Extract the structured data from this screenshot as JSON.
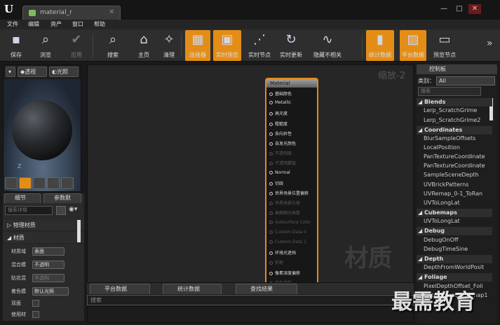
{
  "window": {
    "tab_title": "material_r",
    "min": "—",
    "max": "□",
    "close": "✕"
  },
  "menu": [
    "文件",
    "编辑",
    "资产",
    "窗口",
    "帮助"
  ],
  "toolbar": [
    {
      "label": "保存",
      "icon": "save-icon",
      "glyph": "▪",
      "on": false,
      "dis": false
    },
    {
      "label": "浏览",
      "icon": "browse-icon",
      "glyph": "⌕",
      "on": false,
      "dis": false
    },
    {
      "label": "应用",
      "icon": "apply-icon",
      "glyph": "✔",
      "on": false,
      "dis": true
    },
    {
      "label": "搜索",
      "icon": "search-icon",
      "glyph": "⌕",
      "on": false,
      "dis": false
    },
    {
      "label": "主页",
      "icon": "home-icon",
      "glyph": "⌂",
      "on": false,
      "dis": false
    },
    {
      "label": "清理",
      "icon": "clean-icon",
      "glyph": "✧",
      "on": false,
      "dis": false
    },
    {
      "label": "连接器",
      "icon": "connector-icon",
      "glyph": "▦",
      "on": true,
      "dis": false
    },
    {
      "label": "实时预览",
      "icon": "live-preview-icon",
      "glyph": "▣",
      "on": true,
      "dis": false
    },
    {
      "label": "实时节点",
      "icon": "live-nodes-icon",
      "glyph": "⋰",
      "on": false,
      "dis": false
    },
    {
      "label": "实时更新",
      "icon": "live-update-icon",
      "glyph": "↻",
      "on": false,
      "dis": false
    },
    {
      "label": "隐藏不相关",
      "icon": "hide-unrelated-icon",
      "glyph": "∿",
      "on": false,
      "dis": false
    },
    {
      "label": "统计数据",
      "icon": "stats-icon",
      "glyph": "▮",
      "on": true,
      "dis": false
    },
    {
      "label": "平台数据",
      "icon": "platform-icon",
      "glyph": "▨",
      "on": true,
      "dis": false
    },
    {
      "label": "预览节点",
      "icon": "preview-node-icon",
      "glyph": "▭",
      "on": false,
      "dis": false
    }
  ],
  "viewport": {
    "perspective": "透视",
    "lit": "光照",
    "axis": "Z"
  },
  "details": {
    "tab_details": "细节",
    "tab_params": "参数默",
    "search_placeholder": "搜索详情",
    "section_physical": "▷ 物理材质",
    "section_material": "◢ 材质",
    "props": [
      {
        "label": "材质域",
        "value": "表面",
        "dis": false
      },
      {
        "label": "混合模",
        "value": "不透明",
        "dis": false
      },
      {
        "label": "贴花混",
        "value": "半透明",
        "dis": true
      },
      {
        "label": "着色模",
        "value": "默认光照",
        "dis": false
      }
    ],
    "checks": [
      "双面",
      "使用材"
    ]
  },
  "graph": {
    "zoom": "缩放-2",
    "watermark": "材质",
    "node_title": "Material",
    "pins": [
      {
        "t": "基础颜色",
        "off": false
      },
      {
        "t": "Metallic",
        "off": false
      },
      {
        "t": "高光度",
        "off": false
      },
      {
        "t": "粗糙度",
        "off": false
      },
      {
        "t": "各向异性",
        "off": false
      },
      {
        "t": "自发光颜色",
        "off": false
      },
      {
        "t": "不透明度",
        "off": true
      },
      {
        "t": "不透明蒙版",
        "off": true
      },
      {
        "t": "Normal",
        "off": false
      },
      {
        "t": "切线",
        "off": false
      },
      {
        "t": "世界场景位置偏移",
        "off": false
      },
      {
        "t": "世界场景位移",
        "off": true
      },
      {
        "t": "曲面细分乘数",
        "off": true
      },
      {
        "t": "Subsurface Color",
        "off": true
      },
      {
        "t": "Custom Data 0",
        "off": true
      },
      {
        "t": "Custom Data 1",
        "off": true
      },
      {
        "t": "环境光遮挡",
        "off": false
      },
      {
        "t": "折射",
        "off": true
      },
      {
        "t": "像素深度偏移",
        "off": false
      },
      {
        "t": "着色模型",
        "off": true
      }
    ]
  },
  "bottom": {
    "tabs": [
      "平台数据",
      "统计数据",
      "查找结果"
    ],
    "search_placeholder": "搜索"
  },
  "palette": {
    "title": "控制板",
    "category_label": "类别：",
    "category_value": "All",
    "search_placeholder": "搜索",
    "groups": [
      {
        "name": "◢ Blends",
        "items": [
          "Lerp_ScratchGrime",
          "Lerp_ScratchGrime2"
        ]
      },
      {
        "name": "◢ Coordinates",
        "items": [
          "BlurSampleOffsets",
          "LocalPosition",
          "PanTextureCoordinate",
          "PanTextureCoordinate",
          "SampleSceneDepth",
          "UVBrickPatterns",
          "UVRemap_0-1_ToRan",
          "UVToLongLat"
        ]
      },
      {
        "name": "◢ Cubemaps",
        "items": [
          "UVToLongLat"
        ]
      },
      {
        "name": "◢ Debug",
        "items": [
          "DebugOnOff",
          "DebugTimeSine"
        ]
      },
      {
        "name": "◢ Depth",
        "items": [
          "DepthFromWorldPosit"
        ]
      },
      {
        "name": "◢ Foliage",
        "items": [
          "PixelDepthOffset_Foli",
          "GetAmbientCubemap1"
        ]
      }
    ]
  },
  "brand": "最需教育"
}
